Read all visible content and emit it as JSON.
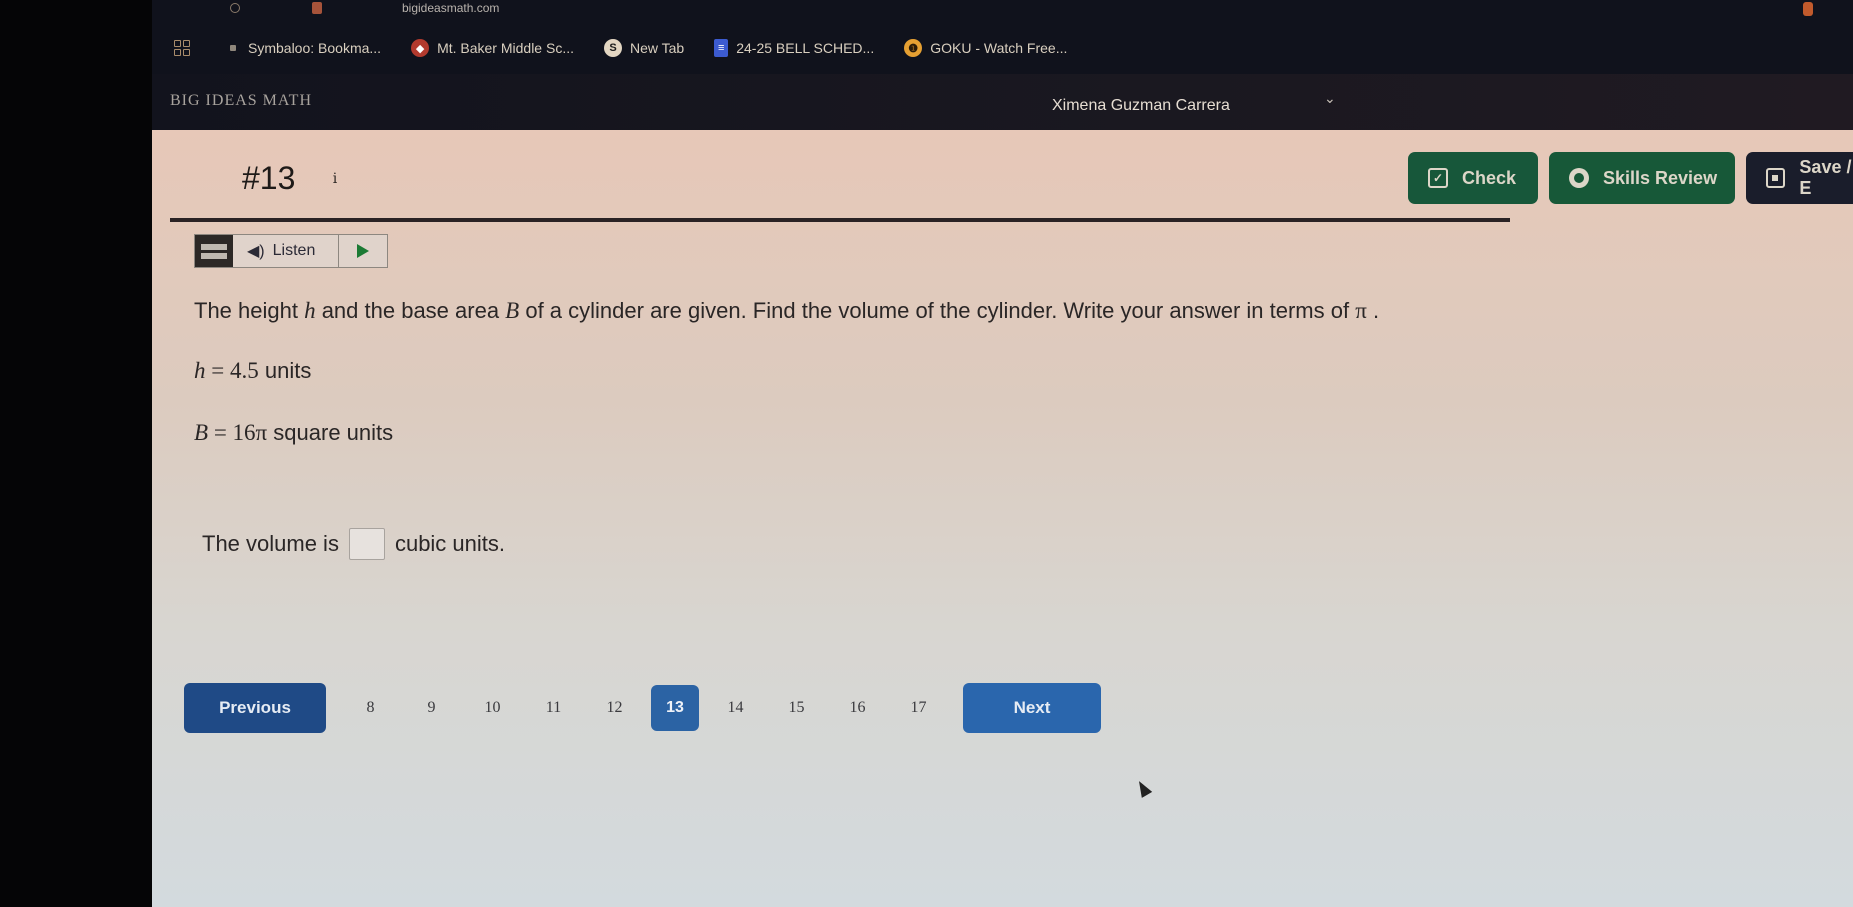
{
  "browser": {
    "url": "bigideasmath.com",
    "bookmarks": [
      {
        "label": "Symbaloo: Bookma...",
        "icon": "symbaloo-icon"
      },
      {
        "label": "Mt. Baker Middle Sc...",
        "icon": "school-icon"
      },
      {
        "label": "New Tab",
        "icon": "globe-icon"
      },
      {
        "label": "24-25 BELL SCHED...",
        "icon": "doc-icon"
      },
      {
        "label": "GOKU - Watch Free...",
        "icon": "goku-icon"
      }
    ]
  },
  "header": {
    "brand": "BIG IDEAS MATH",
    "user_name": "Ximena Guzman Carrera",
    "chevron": "⌄"
  },
  "question": {
    "number": "#13",
    "info_glyph": "i",
    "prompt_parts": {
      "p1": "The height ",
      "var_h": "h",
      "p2": "  and the base area ",
      "var_B": "B",
      "p3": "  of a cylinder are given. Find the volume of the cylinder. Write your answer in terms of ",
      "pi": "π",
      "p4": " ."
    },
    "given_h": {
      "var": "h",
      "eq": " = ",
      "value": "4.5",
      "unit": "  units"
    },
    "given_B": {
      "var": "B",
      "eq": " = ",
      "value": "16π",
      "unit": "  square units"
    },
    "answer": {
      "before": "The volume is",
      "value": "",
      "after": "cubic units."
    }
  },
  "toolbar": {
    "check": "Check",
    "skills_review": "Skills Review",
    "save": "Save / E",
    "listen": "Listen",
    "speaker_glyph": "◀)"
  },
  "pagination": {
    "previous": "Previous",
    "next": "Next",
    "pages": [
      "8",
      "9",
      "10",
      "11",
      "12",
      "13",
      "14",
      "15",
      "16",
      "17"
    ],
    "current": "13"
  },
  "colors": {
    "check_bg": "#17573a",
    "skills_bg": "#175838",
    "save_bg": "#1a1d2b",
    "prev_bg": "#1f4a86",
    "next_bg": "#2a66ad",
    "active_page_bg": "#2b63a4"
  }
}
